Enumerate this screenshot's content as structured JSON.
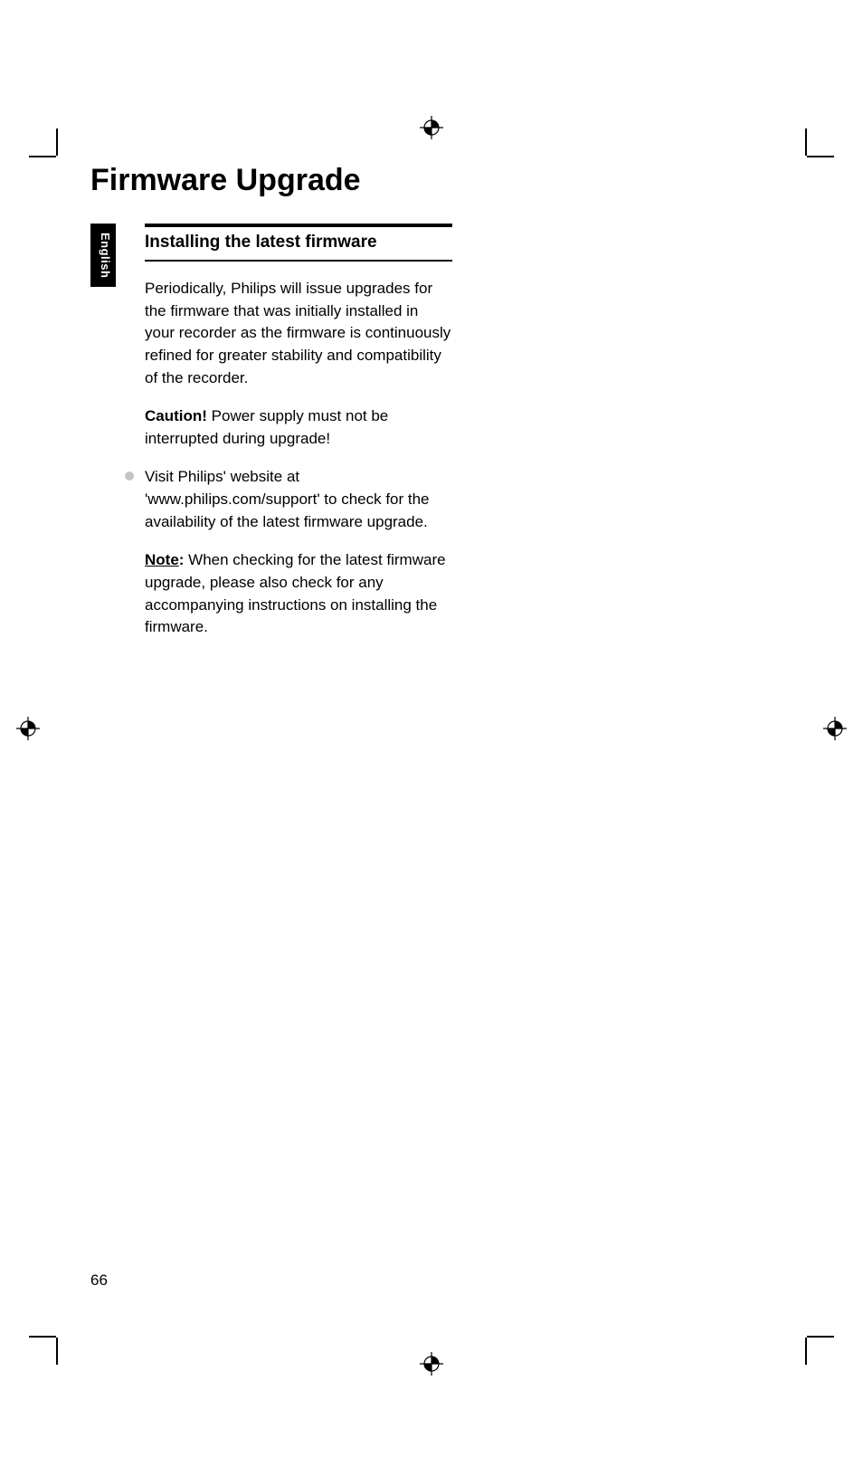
{
  "title": "Firmware Upgrade",
  "language_tab": "English",
  "section_heading": "Installing the latest firmware",
  "intro_para": "Periodically, Philips will issue upgrades for the firmware that was initially installed in your recorder as the firmware is continuously refined for greater stability and compatibility of the recorder.",
  "caution_label": "Caution!",
  "caution_text": " Power supply must not be interrupted during upgrade!",
  "bullet_text": "Visit Philips' website at 'www.philips.com/support' to check for the availability of the latest firmware upgrade.",
  "note_label": "Note",
  "note_colon": ":",
  "note_text": " When checking for the latest firmware upgrade, please also check for any accompanying instructions on installing the firmware.",
  "page_number": "66"
}
